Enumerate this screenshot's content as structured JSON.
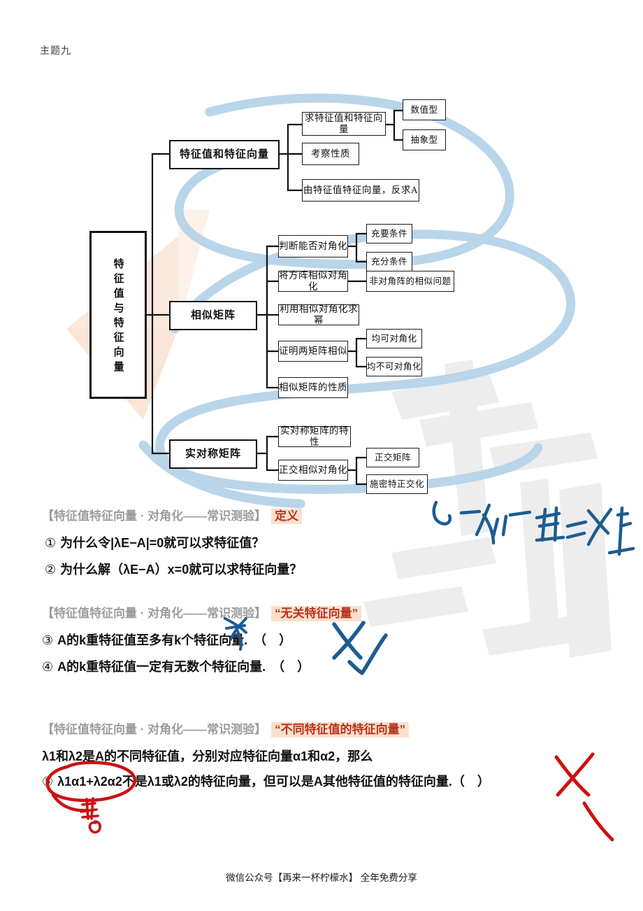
{
  "header": {
    "title": "主题九"
  },
  "footer": {
    "text": "微信公众号【再来一杯柠檬水】 全年免费分享"
  },
  "colors": {
    "ribbon_blue": "#b9d5e9",
    "watermark_peach": "#fae2d2",
    "watermark_gray": "#ebebeb",
    "heading_gray": "#9b9b9b",
    "keyword_red": "#b8321f",
    "keyword_bg": "#fbe0cb",
    "ink_blue": "#1d5c92",
    "ink_red": "#cc1111",
    "node_border": "#1d1d1d"
  },
  "mindmap": {
    "root": {
      "label": "特征值与特征向量"
    },
    "branches": [
      {
        "label": "特征值和特征向量",
        "children": [
          {
            "label": "求特征值和特征向量",
            "children": [
              {
                "label": "数值型"
              },
              {
                "label": "抽象型"
              }
            ]
          },
          {
            "label": "考察性质",
            "children": []
          },
          {
            "label": "由特征值特征向量，反求A",
            "children": []
          }
        ]
      },
      {
        "label": "相似矩阵",
        "children": [
          {
            "label": "判断能否对角化",
            "children": [
              {
                "label": "充要条件"
              },
              {
                "label": "充分条件"
              }
            ]
          },
          {
            "label": "将方阵相似对角化",
            "children": [
              {
                "label": "非对角阵的相似问题"
              }
            ]
          },
          {
            "label": "利用相似对角化求幂",
            "children": []
          },
          {
            "label": "证明两矩阵相似",
            "children": [
              {
                "label": "均可对角化"
              },
              {
                "label": "均不可对角化"
              }
            ]
          },
          {
            "label": "相似矩阵的性质",
            "children": []
          }
        ]
      },
      {
        "label": "实对称矩阵",
        "children": [
          {
            "label": "实对称矩阵的特性",
            "children": []
          },
          {
            "label": "正交相似对角化",
            "children": [
              {
                "label": "正交矩阵"
              },
              {
                "label": "施密特正交化"
              }
            ]
          }
        ]
      }
    ]
  },
  "quiz_blocks": [
    {
      "heading_prefix": "【特征值特征向量 · 对角化——常识测验】",
      "heading_keyword": "定义",
      "lines": [
        {
          "num": "①",
          "text": "为什么令|λE−A|=0就可以求特征值？",
          "mark": "none"
        },
        {
          "num": "②",
          "text": "为什么解（λE−A）x=0就可以求特征向量？",
          "mark": "none"
        }
      ]
    },
    {
      "heading_prefix": "【特征值特征向量 · 对角化——常识测验】",
      "heading_keyword": "“无关特征向量”",
      "lines": [
        {
          "num": "③",
          "text": "A的k重特征值至多有k个特征向量.　（　）",
          "mark": "cross-blue"
        },
        {
          "num": "④",
          "text": "A的k重特征值一定有无数个特征向量.　（　）",
          "mark": "check-blue"
        }
      ]
    },
    {
      "heading_prefix": "【特征值特征向量 · 对角化——常识测验】",
      "heading_keyword": "“不同特征值的特征向量”",
      "lines": [
        {
          "num": "",
          "text": "λ1和λ2是A的不同特征值，分别对应特征向量α1和α2，那么",
          "mark": "none"
        },
        {
          "num": "⑤",
          "text": "λ1α1+λ2α2不是λ1或λ2的特征向量，但可以是A其他特征值的特征向量.（　）",
          "mark": "cross-red"
        }
      ]
    }
  ],
  "annotations": [
    {
      "name": "blue-scrawl-note",
      "kind": "handwriting-blue"
    },
    {
      "name": "blue-cross-item3",
      "kind": "cross-blue"
    },
    {
      "name": "blue-check-item4",
      "kind": "check-blue"
    },
    {
      "name": "blue-squiggle-item3",
      "kind": "squiggle-blue"
    },
    {
      "name": "red-circle-item5",
      "kind": "circle-red"
    },
    {
      "name": "red-neq-zero",
      "kind": "text-red",
      "text": "≠0"
    },
    {
      "name": "red-cross-item5",
      "kind": "cross-red"
    }
  ]
}
